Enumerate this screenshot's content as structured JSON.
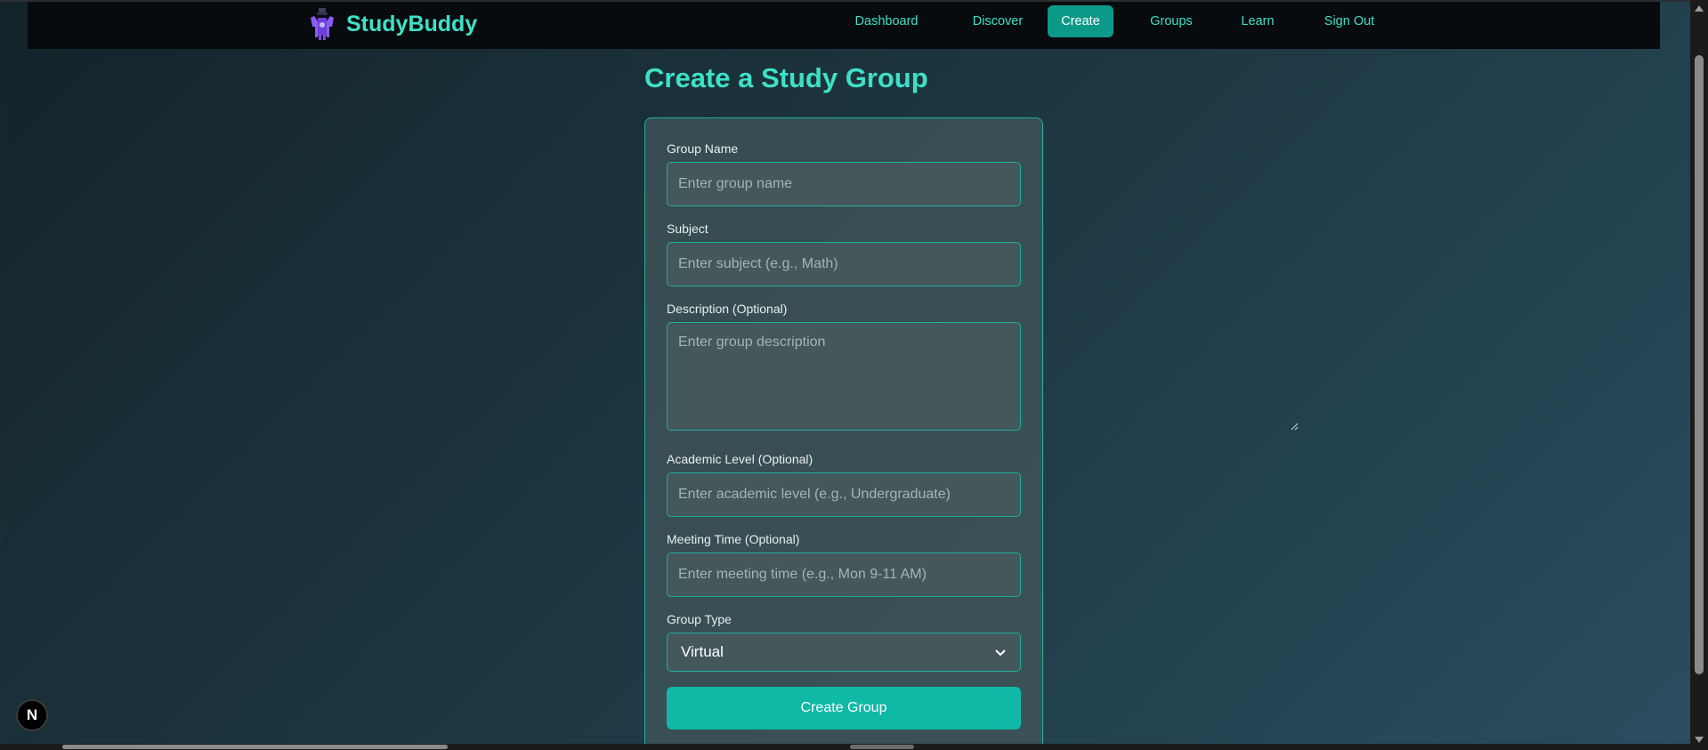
{
  "app": {
    "brand_name": "StudyBuddy",
    "logo_icon": "study-buddy-logo-icon"
  },
  "nav": {
    "items": [
      {
        "label": "Dashboard",
        "active": false
      },
      {
        "label": "Discover",
        "active": false
      },
      {
        "label": "Create",
        "active": true
      },
      {
        "label": "Groups",
        "active": false
      },
      {
        "label": "Learn",
        "active": false
      },
      {
        "label": "Sign Out",
        "active": false
      }
    ]
  },
  "page": {
    "title": "Create a Study Group"
  },
  "form": {
    "group_name": {
      "label": "Group Name",
      "placeholder": "Enter group name",
      "value": ""
    },
    "subject": {
      "label": "Subject",
      "placeholder": "Enter subject (e.g., Math)",
      "value": ""
    },
    "description": {
      "label": "Description (Optional)",
      "placeholder": "Enter group description",
      "value": ""
    },
    "academic_level": {
      "label": "Academic Level (Optional)",
      "placeholder": "Enter academic level (e.g., Undergraduate)",
      "value": ""
    },
    "meeting_time": {
      "label": "Meeting Time (Optional)",
      "placeholder": "Enter meeting time (e.g., Mon 9-11 AM)",
      "value": ""
    },
    "group_type": {
      "label": "Group Type",
      "selected": "Virtual"
    },
    "submit_label": "Create Group"
  },
  "dev_badge": {
    "label": "N"
  },
  "colors": {
    "accent": "#3ee0c8",
    "button": "#0fb9a6",
    "active_nav": "#0c9a88",
    "border": "#1fae9c"
  }
}
